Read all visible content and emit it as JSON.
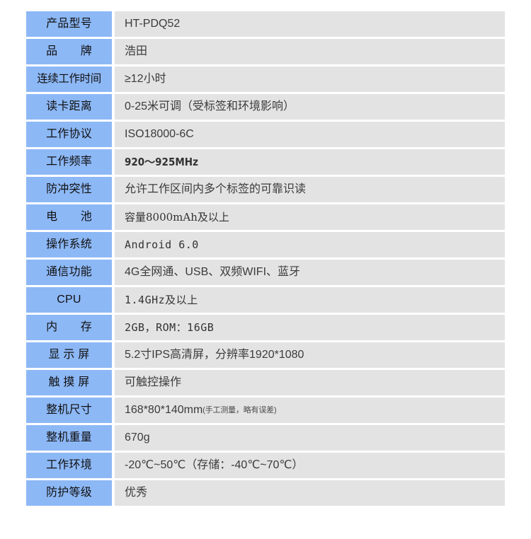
{
  "colors": {
    "label_background": "#8db8f6",
    "value_background": "#e3e3e3",
    "page_background": "#ffffff",
    "label_text": "#101010",
    "value_text": "#3b3b3b"
  },
  "table": {
    "rows": [
      {
        "label": "产品型号",
        "value": "HT-PDQ52",
        "note": ""
      },
      {
        "label": "品　　牌",
        "value": "浩田",
        "note": ""
      },
      {
        "label": "连续工作时间",
        "value": "≥12小时",
        "note": ""
      },
      {
        "label": "读卡距离",
        "value": "0-25米可调（受标签和环境影响）",
        "note": ""
      },
      {
        "label": "工作协议",
        "value": "ISO18000-6C",
        "note": ""
      },
      {
        "label": "工作频率",
        "value": "920〜925MHz",
        "note": ""
      },
      {
        "label": "防冲突性",
        "value": "允许工作区间内多个标签的可靠识读",
        "note": ""
      },
      {
        "label": "电　　池",
        "value": "容量8000mAh及以上",
        "note": ""
      },
      {
        "label": "操作系统",
        "value": "Android 6.0",
        "note": ""
      },
      {
        "label": "通信功能",
        "value": "4G全网通、USB、双频WIFI、蓝牙",
        "note": ""
      },
      {
        "label": "CPU",
        "value": "1.4GHz及以上",
        "note": ""
      },
      {
        "label": "内　　存",
        "value": "2GB，ROM：16GB",
        "note": ""
      },
      {
        "label": "显 示 屏",
        "value": "5.2寸IPS高清屏，分辨率1920*1080",
        "note": ""
      },
      {
        "label": "触 摸 屏",
        "value": "可触控操作",
        "note": ""
      },
      {
        "label": "整机尺寸",
        "value": "168*80*140mm",
        "note": "(手工测量，略有误差)"
      },
      {
        "label": "整机重量",
        "value": "670g",
        "note": ""
      },
      {
        "label": "工作环境",
        "value": "-20℃~50℃（存储：-40℃~70℃）",
        "note": ""
      },
      {
        "label": "防护等级",
        "value": "优秀",
        "note": ""
      }
    ]
  }
}
